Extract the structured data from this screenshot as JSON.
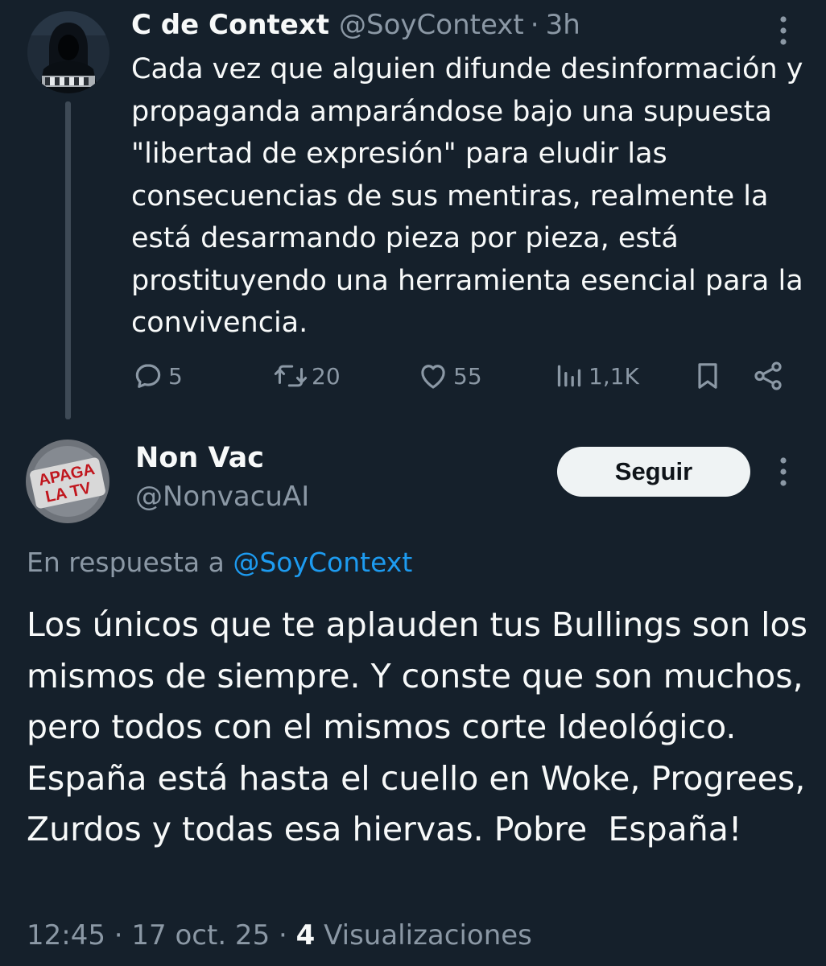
{
  "colors": {
    "background": "#15202b",
    "text_primary": "#f7f9f9",
    "text_secondary": "#8b98a5",
    "link": "#1d9bf0",
    "follow_button_bg": "#eff3f4",
    "thread_line": "#3e4a56"
  },
  "parent_tweet": {
    "avatar_icon": "hooded-figure-avatar",
    "author_name": "C de Context",
    "author_handle": "@SoyContext",
    "separator": "·",
    "time": "3h",
    "text": "Cada vez que alguien difunde desinformación y propaganda amparándose bajo una supuesta \"libertad de expresión\" para eludir las consecuencias de sus mentiras, realmente la está desarmando pieza por pieza, está prostituyendo una herramienta esencial para la convivencia.",
    "actions": {
      "replies": {
        "icon": "reply-icon",
        "count": "5"
      },
      "retweets": {
        "icon": "retweet-icon",
        "count": "20"
      },
      "likes": {
        "icon": "heart-icon",
        "count": "55"
      },
      "views": {
        "icon": "views-icon",
        "count": "1,1K"
      },
      "bookmark": {
        "icon": "bookmark-icon"
      },
      "share": {
        "icon": "share-icon"
      }
    }
  },
  "reply_tweet": {
    "avatar_icon": "apaga-la-tv-avatar",
    "avatar_text": "APAGA LA TV",
    "author_name": "Non Vac",
    "author_handle": "@NonvacuAI",
    "follow_label": "Seguir",
    "reply_prefix": "En respuesta a",
    "reply_mention": "@SoyContext",
    "text": "Los únicos que te aplauden tus Bullings son los mismos de siempre. Y conste que son muchos, pero todos con el mismos corte Ideológico. España está hasta el cuello en Woke, Progrees, Zurdos y todas esa hiervas. Pobre  España!",
    "meta": {
      "time": "12:45",
      "date": "17 oct. 25",
      "separator": "·",
      "views_count": "4",
      "views_label": "Visualizaciones"
    }
  }
}
